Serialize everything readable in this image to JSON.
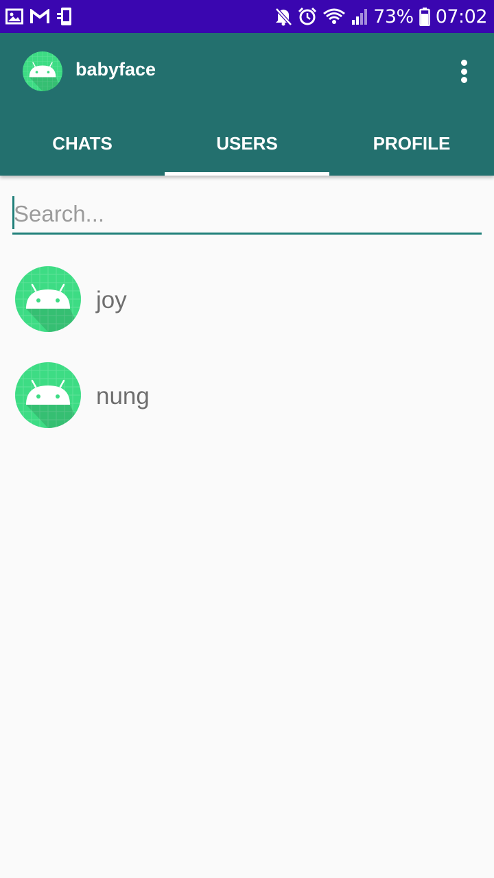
{
  "status_bar": {
    "battery": "73%",
    "time": "07:02",
    "left_icons": [
      "gallery-icon",
      "gmail-icon",
      "device-icon"
    ],
    "right_icons": [
      "mute-icon",
      "alarm-icon",
      "wifi-icon",
      "signal-icon",
      "battery-icon"
    ]
  },
  "app_bar": {
    "title": "babyface",
    "logo_icon": "android-icon",
    "menu_icon": "more-vert-icon",
    "color": "#23706e"
  },
  "tabs": [
    {
      "label": "CHATS",
      "active": false
    },
    {
      "label": "USERS",
      "active": true
    },
    {
      "label": "PROFILE",
      "active": false
    }
  ],
  "search": {
    "placeholder": "Search...",
    "value": ""
  },
  "users": [
    {
      "name": "joy",
      "avatar_icon": "android-icon"
    },
    {
      "name": "nung",
      "avatar_icon": "android-icon"
    }
  ],
  "colors": {
    "status_bar": "#3a06b0",
    "accent": "#1f7f79",
    "avatar_green": "#3ddc84"
  }
}
